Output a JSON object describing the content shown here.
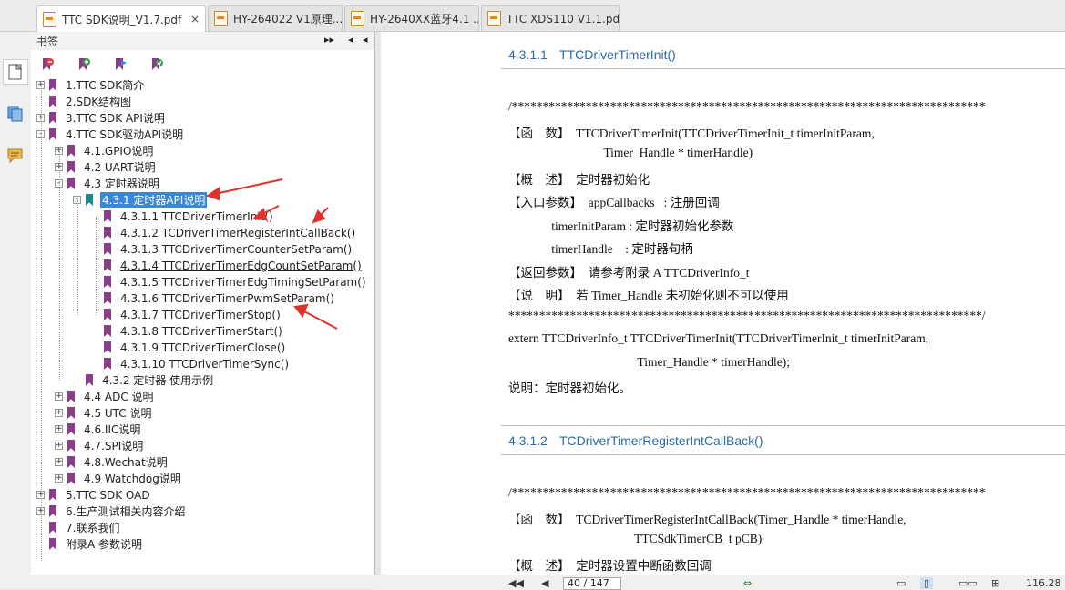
{
  "tabs": [
    {
      "label": "TTC SDK说明_V1.7.pdf",
      "active": true,
      "close": "×"
    },
    {
      "label": "HY-264022 V1原理...",
      "active": false
    },
    {
      "label": "HY-2640XX蓝牙4.1 ...",
      "active": false
    },
    {
      "label": "TTC XDS110 V1.1.pdf",
      "active": false
    }
  ],
  "bookmarks_panel": {
    "title": "书签",
    "header_controls": [
      "▸▸",
      "◂",
      "◂"
    ],
    "tools": [
      "delete-bookmark-icon",
      "add-bookmark-icon",
      "expand-bookmark-icon",
      "find-bookmark-icon"
    ]
  },
  "tree": [
    {
      "label": "1.TTC SDK简介",
      "level": 0,
      "exp": "+"
    },
    {
      "label": "2.SDK结构图",
      "level": 0,
      "exp": ""
    },
    {
      "label": "3.TTC SDK API说明",
      "level": 0,
      "exp": "+"
    },
    {
      "label": "4.TTC SDK驱动API说明",
      "level": 0,
      "exp": "-"
    },
    {
      "label": "4.1.GPIO说明",
      "level": 1,
      "exp": "+"
    },
    {
      "label": "4.2 UART说明",
      "level": 1,
      "exp": "+"
    },
    {
      "label": "4.3 定时器说明",
      "level": 1,
      "exp": "-"
    },
    {
      "label": "4.3.1 定时器API说明",
      "level": 2,
      "exp": "-",
      "selected": true
    },
    {
      "label": "4.3.1.1  TTCDriverTimerInit()",
      "level": 3,
      "exp": ""
    },
    {
      "label": "4.3.1.2  TCDriverTimerRegisterIntCallBack()",
      "level": 3,
      "exp": ""
    },
    {
      "label": "4.3.1.3  TTCDriverTimerCounterSetParam()",
      "level": 3,
      "exp": ""
    },
    {
      "label": "4.3.1.4  TTCDriverTimerEdgCountSetParam()",
      "level": 3,
      "exp": "",
      "underline": true
    },
    {
      "label": "4.3.1.5  TTCDriverTimerEdgTimingSetParam()",
      "level": 3,
      "exp": ""
    },
    {
      "label": "4.3.1.6  TTCDriverTimerPwmSetParam()",
      "level": 3,
      "exp": ""
    },
    {
      "label": "4.3.1.7  TTCDriverTimerStop()",
      "level": 3,
      "exp": ""
    },
    {
      "label": "4.3.1.8  TTCDriverTimerStart()",
      "level": 3,
      "exp": ""
    },
    {
      "label": "4.3.1.9  TTCDriverTimerClose()",
      "level": 3,
      "exp": ""
    },
    {
      "label": "4.3.1.10  TTCDriverTimerSync()",
      "level": 3,
      "exp": ""
    },
    {
      "label": "4.3.2 定时器 使用示例",
      "level": 2,
      "exp": ""
    },
    {
      "label": "4.4 ADC 说明",
      "level": 1,
      "exp": "+"
    },
    {
      "label": "4.5 UTC 说明",
      "level": 1,
      "exp": "+"
    },
    {
      "label": "4.6.IIC说明",
      "level": 1,
      "exp": "+"
    },
    {
      "label": "4.7.SPI说明",
      "level": 1,
      "exp": "+"
    },
    {
      "label": "4.8.Wechat说明",
      "level": 1,
      "exp": "+"
    },
    {
      "label": "4.9 Watchdog说明",
      "level": 1,
      "exp": "+"
    },
    {
      "label": "5.TTC SDK OAD",
      "level": 0,
      "exp": "+"
    },
    {
      "label": "6.生产测试相关内容介绍",
      "level": 0,
      "exp": "+"
    },
    {
      "label": "7.联系我们",
      "level": 0,
      "exp": ""
    },
    {
      "label": "附录A 参数说明",
      "level": 0,
      "exp": ""
    }
  ],
  "document": {
    "section1": {
      "num": "4.3.1.1",
      "title": "TTCDriverTimerInit()"
    },
    "section2": {
      "num": "4.3.1.2",
      "title": "TCDriverTimerRegisterIntCallBack()"
    },
    "lines": [
      "/*****************************************************************************",
      "【函    数】  TTCDriverTimerInit(TTCDriverTimerInit_t timerInitParam,",
      "                               Timer_Handle * timerHandle)",
      "【概    述】  定时器初始化",
      "【入口参数】  appCallbacks   : 注册回调",
      "              timerInitParam : 定时器初始化参数",
      "              timerHandle    : 定时器句柄",
      "【返回参数】  请参考附录 A TTCDriverInfo_t",
      "【说    明】  若 Timer_Handle 未初始化则不可以使用",
      "*****************************************************************************/",
      "extern TTCDriverInfo_t TTCDriverTimerInit(TTCDriverTimerInit_t timerInitParam,",
      "                                          Timer_Handle * timerHandle);",
      "说明：定时器初始化。"
    ],
    "lines2": [
      "/*****************************************************************************",
      "【函    数】  TCDriverTimerRegisterIntCallBack(Timer_Handle * timerHandle,",
      "                                         TTCSdkTimerCB_t pCB)",
      "【概    述】  定时器设置中断函数回调"
    ]
  },
  "statusbar": {
    "page_value": "40 / 147",
    "zoom": "116.28"
  },
  "colors": {
    "selection": "#3b87d6",
    "bookmark": "#8a3e8a",
    "bookmark_active": "#1f8a8a",
    "heading": "#2a6aa8",
    "arrow": "#e0322a"
  }
}
